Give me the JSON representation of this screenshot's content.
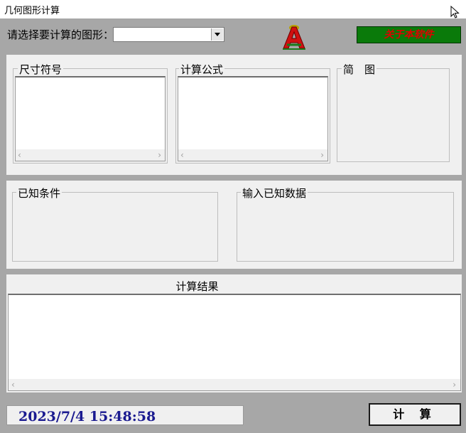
{
  "window": {
    "title": "几何图形计算"
  },
  "toolbar": {
    "choose_label": "请选择要计算的图形：",
    "shape_select_value": "",
    "about_button_label": "关于本软件"
  },
  "groups": {
    "symbols_title": "尺寸符号",
    "formula_title": "计算公式",
    "diagram_title": "简　图",
    "known_conditions_title": "已知条件",
    "input_data_title": "输入已知数据",
    "result_title": "计算结果"
  },
  "status": {
    "datetime": "2023/7/4 15:48:58"
  },
  "actions": {
    "calculate_label": "计 算"
  },
  "colors": {
    "about_bg": "#0a7a0a",
    "about_text": "#e00000",
    "datetime_text": "#1a1a90",
    "window_bg": "#a7a7a7",
    "panel_bg": "#f0f0f0"
  },
  "icons": {
    "logo": "red-letter-a-logo-icon",
    "cursor": "mouse-pointer-icon",
    "dropdown": "chevron-down-icon",
    "scroll_left": "scroll-left-arrow-icon",
    "scroll_right": "scroll-right-arrow-icon"
  }
}
